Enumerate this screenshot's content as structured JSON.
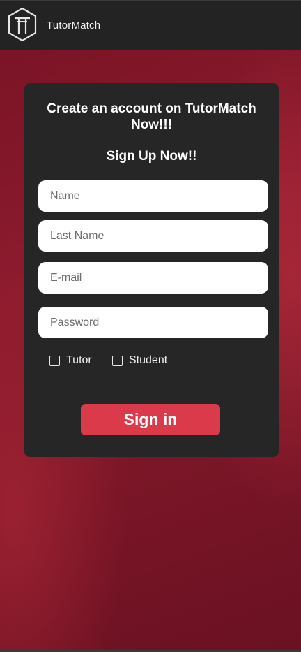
{
  "header": {
    "brand": "TutorMatch",
    "logo_icon": "tutormatch-logo-icon"
  },
  "signup": {
    "title": "Create an account on TutorMatch Now!!!",
    "subtitle": "Sign Up Now!!",
    "fields": {
      "name_placeholder": "Name",
      "last_name_placeholder": "Last Name",
      "email_placeholder": "E-mail",
      "password_placeholder": "Password"
    },
    "roles": {
      "tutor_label": "Tutor",
      "student_label": "Student",
      "tutor_checked": false,
      "student_checked": false
    },
    "submit_label": "Sign in"
  },
  "colors": {
    "header_bg": "#232323",
    "card_bg": "#262626",
    "accent": "#db3a4b",
    "background": "#7a1426"
  }
}
